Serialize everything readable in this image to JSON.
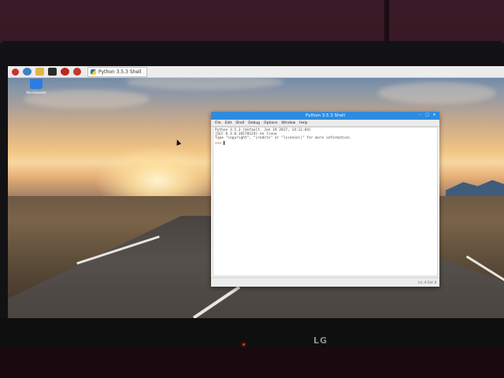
{
  "taskbar": {
    "task_button_label": "Python 3.5.3 Shell",
    "launcher_icons": [
      "raspberry-menu-icon",
      "web-browser-icon",
      "file-manager-icon",
      "terminal-icon",
      "mathematica-icon",
      "wolfram-icon"
    ]
  },
  "desktop": {
    "trash_label": "Wastebasket"
  },
  "window": {
    "title": "Python 3.5.3 Shell",
    "menu": [
      "File",
      "Edit",
      "Shell",
      "Debug",
      "Options",
      "Window",
      "Help"
    ],
    "lines": [
      "Python 3.5.3 (default, Jan 19 2017, 14:11:04)",
      "[GCC 6.3.0 20170124] on linux",
      "Type \"copyright\", \"credits\" or \"license()\" for more information."
    ],
    "prompt": ">>> ",
    "status": "Ln: 4  Col: 4"
  },
  "monitor": {
    "brand": "LG"
  },
  "colors": {
    "titlebar": "#2d8ce0",
    "taskbar": "#ececec",
    "power_led": "#ff2a2a"
  }
}
